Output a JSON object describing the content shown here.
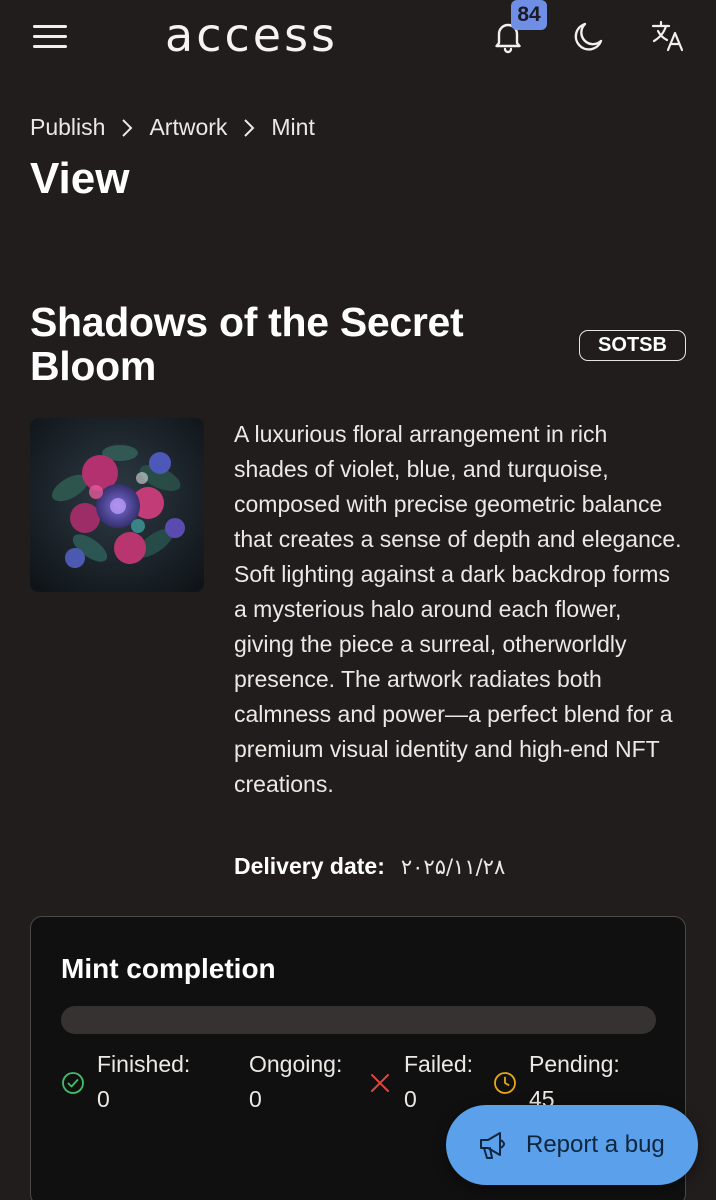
{
  "header": {
    "logo_text": "access",
    "notification_count": "84",
    "icons": [
      "menu-icon",
      "bell-icon",
      "moon-icon",
      "translate-icon"
    ]
  },
  "breadcrumb": [
    "Publish",
    "Artwork",
    "Mint"
  ],
  "page_title": "View",
  "artwork": {
    "title": "Shadows of the Secret Bloom",
    "symbol": "SOTSB",
    "description": "A luxurious floral arrangement in rich shades of violet, blue, and turquoise, composed with precise geometric balance that creates a sense of depth and elegance. Soft lighting against a dark backdrop forms a mysterious halo around each flower, giving the piece a surreal, otherworldly presence. The artwork radiates both calmness and power—a perfect blend for a premium visual identity and high-end NFT creations.",
    "delivery_label": "Delivery date:",
    "delivery_date": "۲۰۲۵/۱۱/۲۸"
  },
  "mint": {
    "title": "Mint completion",
    "progress_fraction": 0,
    "stats": [
      {
        "label": "Finished:",
        "value": "0",
        "icon": "check-circle-icon",
        "color": "#3fbf6a"
      },
      {
        "label": "Ongoing:",
        "value": "0",
        "icon": "",
        "color": ""
      },
      {
        "label": "Failed:",
        "value": "0",
        "icon": "x-icon",
        "color": "#e0463f"
      },
      {
        "label": "Pending:",
        "value": "45",
        "icon": "clock-icon",
        "color": "#e6a817"
      }
    ]
  },
  "report_bug": {
    "label": "Report a bug",
    "icon": "megaphone-icon"
  },
  "colors": {
    "background": "#211d1c",
    "accent": "#6f8ee6",
    "report_button": "#5aa0ea",
    "card_background": "#111010"
  }
}
